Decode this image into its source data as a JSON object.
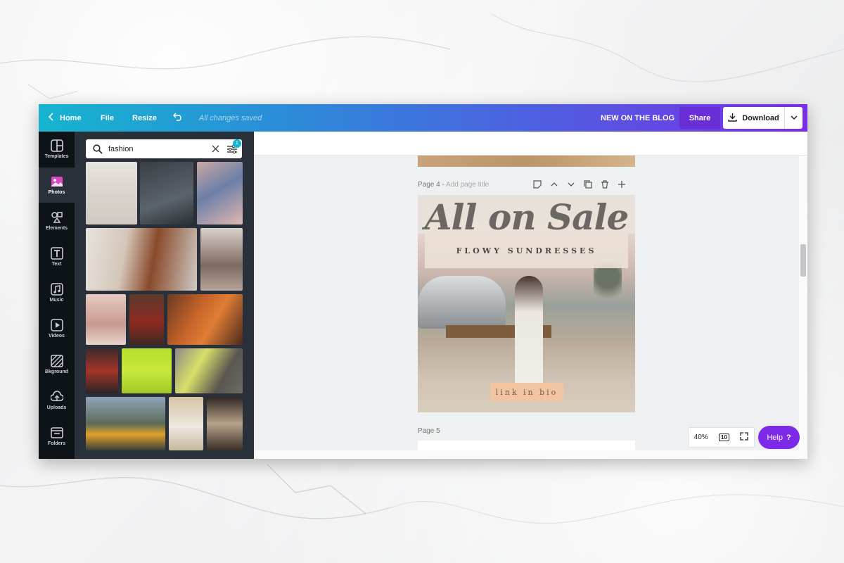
{
  "topbar": {
    "home_label": "Home",
    "file_label": "File",
    "resize_label": "Resize",
    "saved_status": "All changes saved",
    "design_title": "NEW ON THE BLOG",
    "share_label": "Share",
    "download_label": "Download"
  },
  "rail": {
    "items": [
      {
        "label": "Templates",
        "icon": "templates-icon"
      },
      {
        "label": "Photos",
        "icon": "photos-icon"
      },
      {
        "label": "Elements",
        "icon": "elements-icon"
      },
      {
        "label": "Text",
        "icon": "text-icon"
      },
      {
        "label": "Music",
        "icon": "music-icon"
      },
      {
        "label": "Videos",
        "icon": "videos-icon"
      },
      {
        "label": "Bkground",
        "icon": "background-icon"
      },
      {
        "label": "Uploads",
        "icon": "uploads-icon"
      },
      {
        "label": "Folders",
        "icon": "folders-icon"
      }
    ],
    "active": "Photos"
  },
  "search": {
    "value": "fashion",
    "filter_badge": "1"
  },
  "pages": {
    "page4_label": "Page 4 -",
    "page4_title_placeholder": "Add page title",
    "page5_label": "Page 5"
  },
  "design": {
    "title": "All on Sale",
    "subtitle": "FLOWY SUNDRESSES",
    "cta": "link in bio"
  },
  "zoom": {
    "level": "40%",
    "page_count": "10"
  },
  "help": {
    "label": "Help",
    "glyph": "?"
  },
  "colors": {
    "accent_purple": "#7c2ae8",
    "teal": "#16b4cf",
    "panel_dark": "#293039",
    "cta_peach": "#f2c5a2"
  }
}
